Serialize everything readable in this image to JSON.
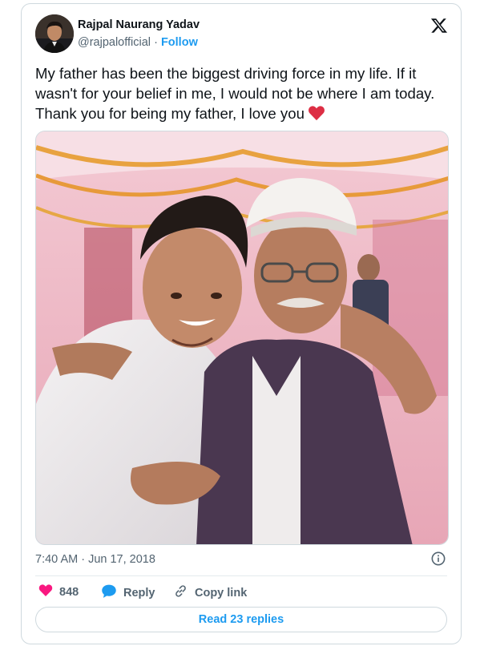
{
  "author": {
    "name": "Rajpal Naurang Yadav",
    "handle": "@rajpalofficial",
    "separator": "·",
    "follow_label": "Follow"
  },
  "tweet": {
    "text": "My father has been the biggest driving force in my life. If it wasn't for your belief in me, I would not be where I am today. Thank you for being my father, I love you",
    "timestamp": "7:40 AM · Jun 17, 2018"
  },
  "actions": {
    "likes": "848",
    "reply_label": "Reply",
    "copy_link_label": "Copy link"
  },
  "read_replies_label": "Read 23 replies",
  "colors": {
    "accent": "#1d9bf0",
    "heart": "#f91880",
    "text": "#0f1419",
    "muted": "#536471"
  },
  "icons": [
    "x-logo-icon",
    "heart-emoji-icon",
    "info-icon",
    "heart-icon",
    "reply-bubble-icon",
    "link-icon"
  ]
}
